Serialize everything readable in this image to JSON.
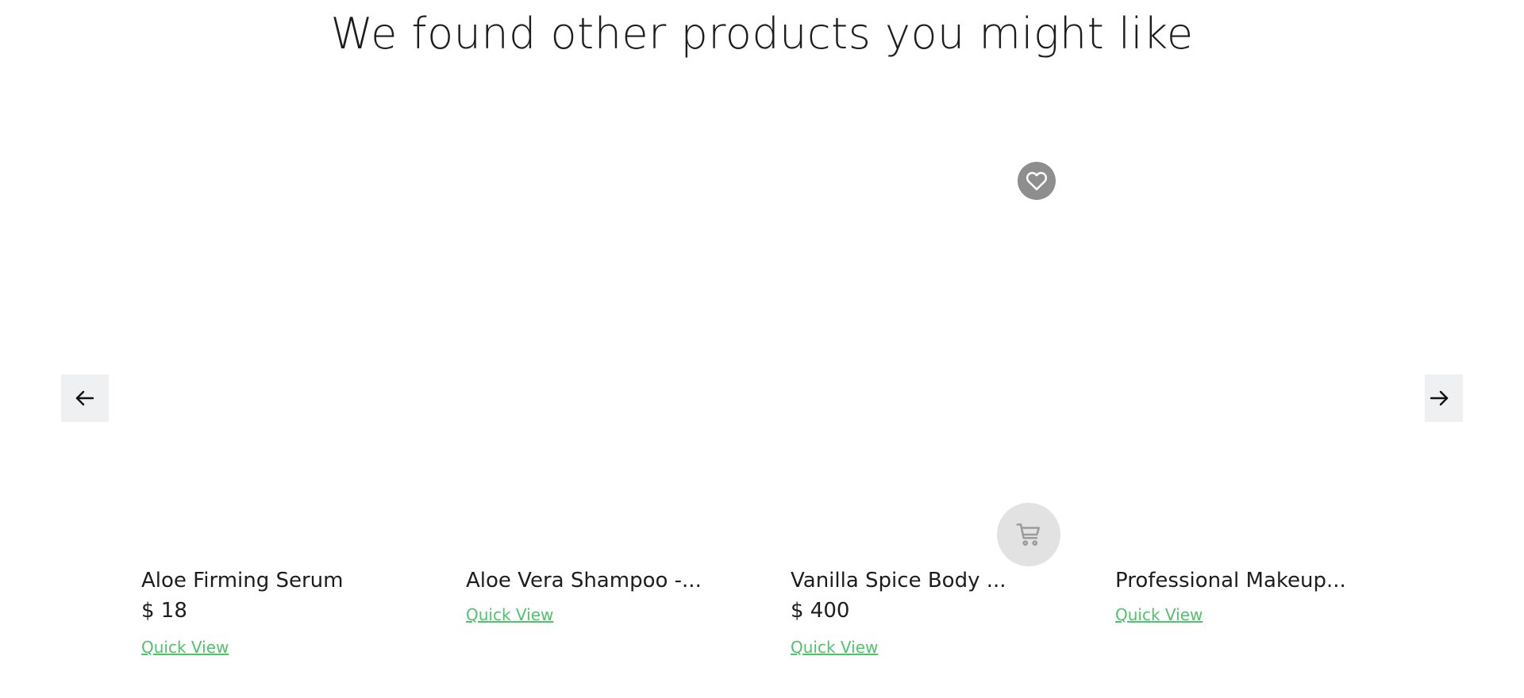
{
  "heading": "We found other products you might like",
  "carousel": {
    "prev_icon": "arrow-left-icon",
    "next_icon": "arrow-right-icon"
  },
  "products": [
    {
      "name": "Aloe Firming Serum",
      "price": "$ 18",
      "quick_view": "Quick View"
    },
    {
      "name": "Aloe Vera Shampoo -...",
      "price": "",
      "quick_view": "Quick View"
    },
    {
      "name": "Vanilla Spice Body ...",
      "price": "$ 400",
      "quick_view": "Quick View"
    },
    {
      "name": "Professional Makeup...",
      "price": "",
      "quick_view": "Quick View"
    }
  ],
  "actions": {
    "wishlist_icon": "heart-icon",
    "cart_icon": "shopping-cart-icon"
  },
  "colors": {
    "link": "#4ec36a",
    "text": "#1d1d1f",
    "arrow_bg": "#eef0f2",
    "wishlist_bg": "#8e8e8e",
    "cart_bg": "#e2e2e2"
  }
}
